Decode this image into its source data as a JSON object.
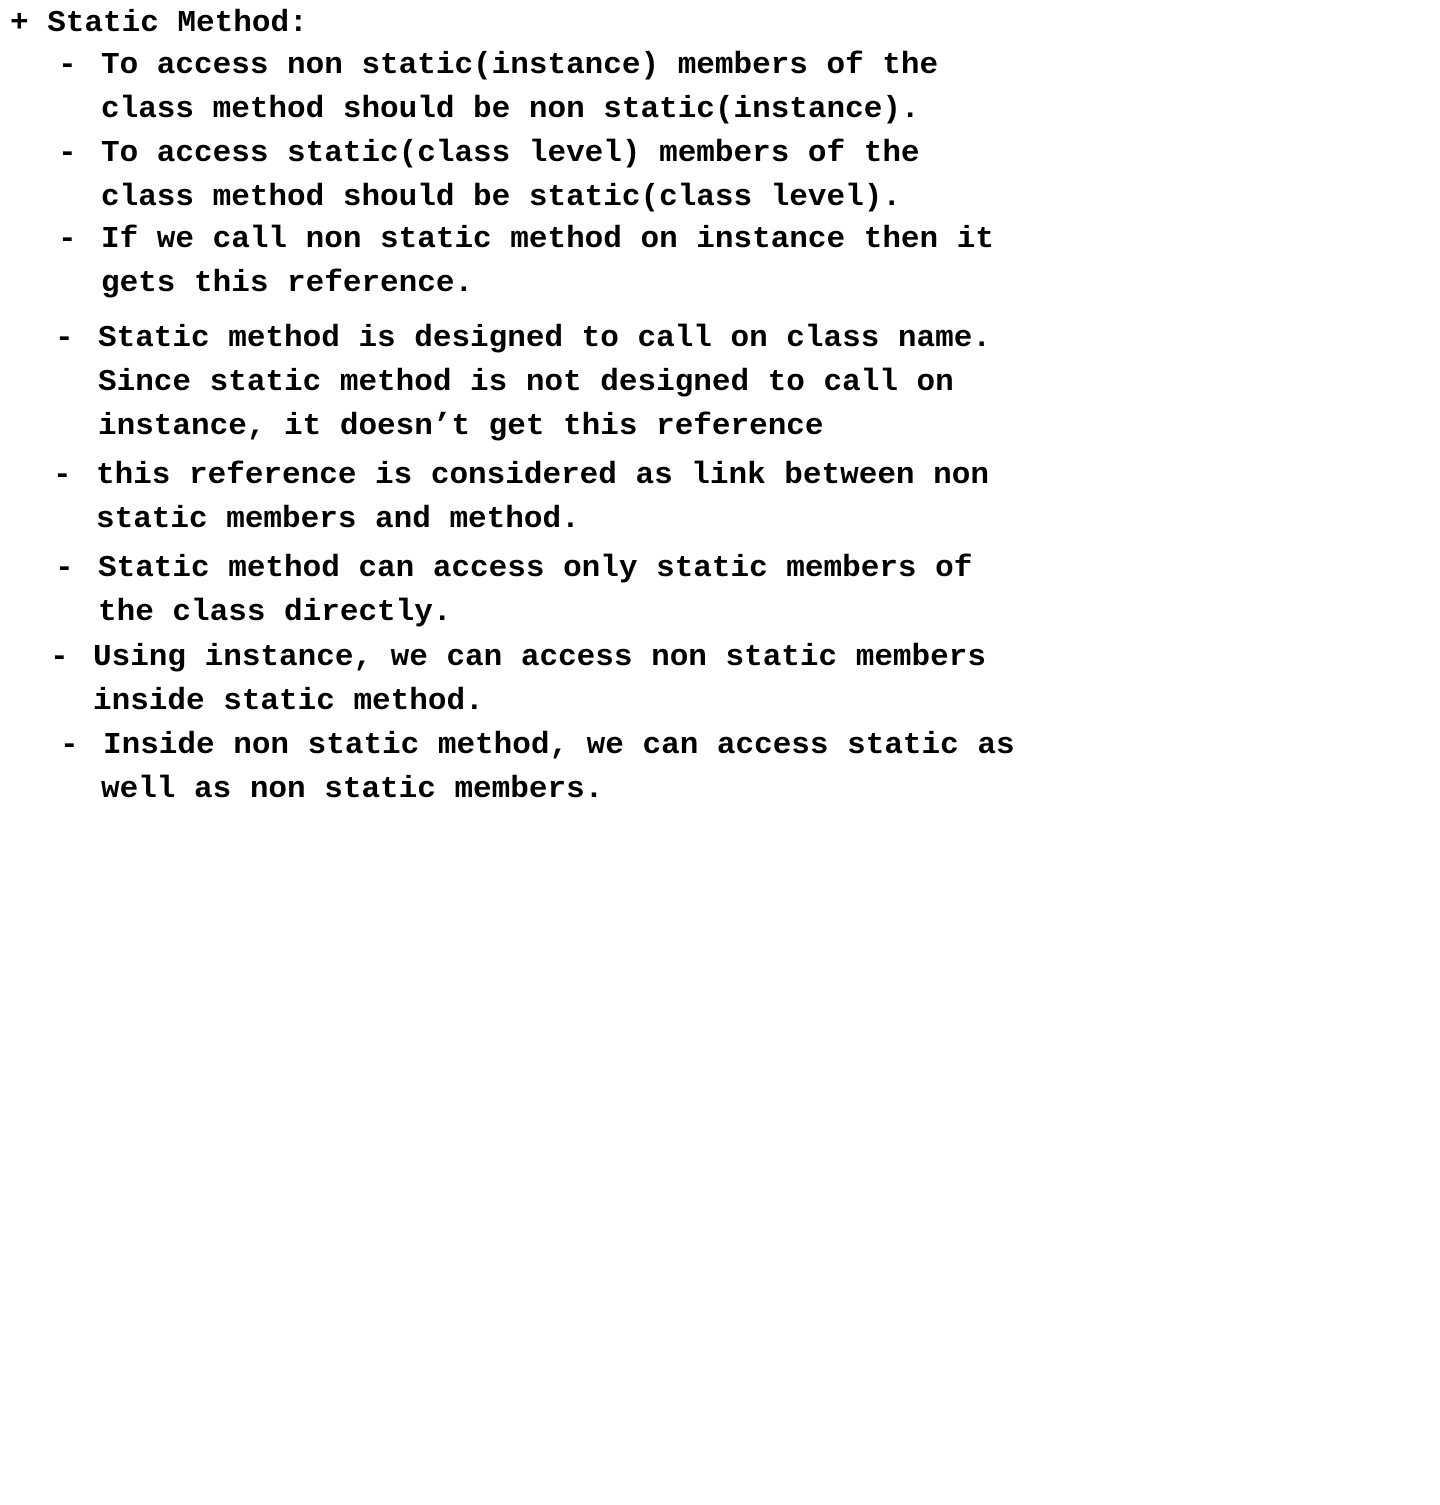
{
  "heading": "+ Static Method:",
  "points": [
    {
      "bullet": "-",
      "lines": [
        "To access non static(instance) members of the",
        "class method should be non static(instance)."
      ]
    },
    {
      "bullet": "-",
      "lines": [
        "To access static(class level) members of the",
        "class method should be static(class level)."
      ]
    },
    {
      "bullet": "-",
      "lines": [
        "If we call non static method on instance then it",
        "gets this reference."
      ]
    },
    {
      "bullet": "-",
      "lines": [
        "Static method is designed to call on class name.",
        "Since static method is not designed to call on",
        "instance, it doesn’t get this reference"
      ]
    },
    {
      "bullet": "-",
      "lines": [
        "this reference is considered as link between non",
        "static members and method."
      ]
    },
    {
      "bullet": "-",
      "lines": [
        "Static method can access only static members of",
        "the class directly."
      ]
    },
    {
      "bullet": "-",
      "lines": [
        "Using instance, we can access non static members",
        "inside static method."
      ]
    },
    {
      "bullet": "-",
      "lines": [
        "Inside non static method, we can access static as",
        "well as non static members."
      ]
    }
  ]
}
